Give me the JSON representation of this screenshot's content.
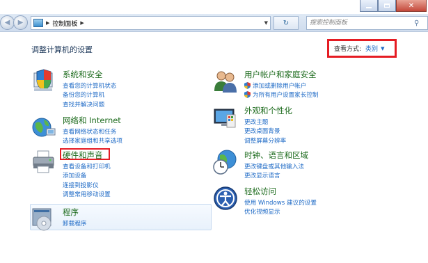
{
  "window": {
    "breadcrumb": "控制面板",
    "search_placeholder": "搜索控制面板",
    "minimize_icon": "minimize-icon",
    "maximize_icon": "maximize-icon",
    "close_icon": "close-icon"
  },
  "header": {
    "title": "调整计算机的设置",
    "view_by_label": "查看方式:",
    "view_by_value": "类别"
  },
  "categories": [
    {
      "title": "系统和安全",
      "icon": "shield-computer-icon",
      "links": [
        "查看您的计算机状态",
        "备份您的计算机",
        "查找并解决问题"
      ]
    },
    {
      "title": "网络和 Internet",
      "icon": "network-globe-icon",
      "links": [
        "查看网络状态和任务",
        "选择家庭组和共享选项"
      ]
    },
    {
      "title": "硬件和声音",
      "icon": "printer-icon",
      "links": [
        "查看设备和打印机",
        "添加设备",
        "连接到投影仪",
        "调整常用移动设置"
      ]
    },
    {
      "title": "程序",
      "icon": "programs-icon",
      "links": [
        "卸载程序"
      ]
    },
    {
      "title": "用户帐户和家庭安全",
      "icon": "users-icon",
      "links": [
        "添加或删除用户帐户",
        "为所有用户设置家长控制"
      ]
    },
    {
      "title": "外观和个性化",
      "icon": "monitor-paint-icon",
      "links": [
        "更改主题",
        "更改桌面背景",
        "调整屏幕分辨率"
      ]
    },
    {
      "title": "时钟、语言和区域",
      "icon": "clock-globe-icon",
      "links": [
        "更改键盘或其他输入法",
        "更改显示语言"
      ]
    },
    {
      "title": "轻松访问",
      "icon": "ease-of-access-icon",
      "links": [
        "使用 Windows 建议的设置",
        "优化视频显示"
      ]
    }
  ],
  "colors": {
    "category_title": "#1d6b1d",
    "link": "#1e6ac6",
    "highlight": "#e51c23"
  }
}
